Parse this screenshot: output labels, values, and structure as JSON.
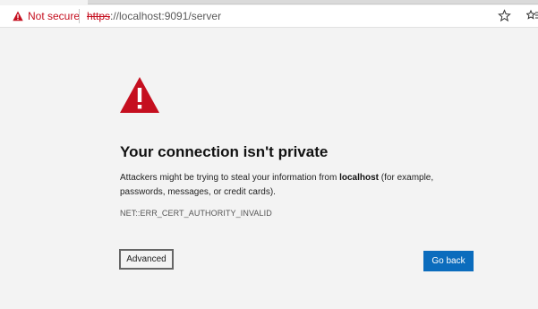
{
  "addressbar": {
    "security_label": "Not secure",
    "url_scheme": "https",
    "url_rest": "://localhost:9091/server"
  },
  "page": {
    "title": "Your connection isn't private",
    "desc_before": "Attackers might be trying to steal your information from ",
    "desc_host": "localhost",
    "desc_after": " (for example, passwords, messages, or credit cards).",
    "error_code": "NET::ERR_CERT_AUTHORITY_INVALID"
  },
  "buttons": {
    "advanced_label": "Advanced",
    "go_back_label": "Go back"
  },
  "icons": {
    "warning": "warning-triangle-icon",
    "favorite": "star-icon",
    "favorites_bar": "favorites-icon"
  },
  "colors": {
    "danger": "#c50f1f",
    "primary_button": "#0b6cbd",
    "page_background": "#f3f3f3"
  }
}
